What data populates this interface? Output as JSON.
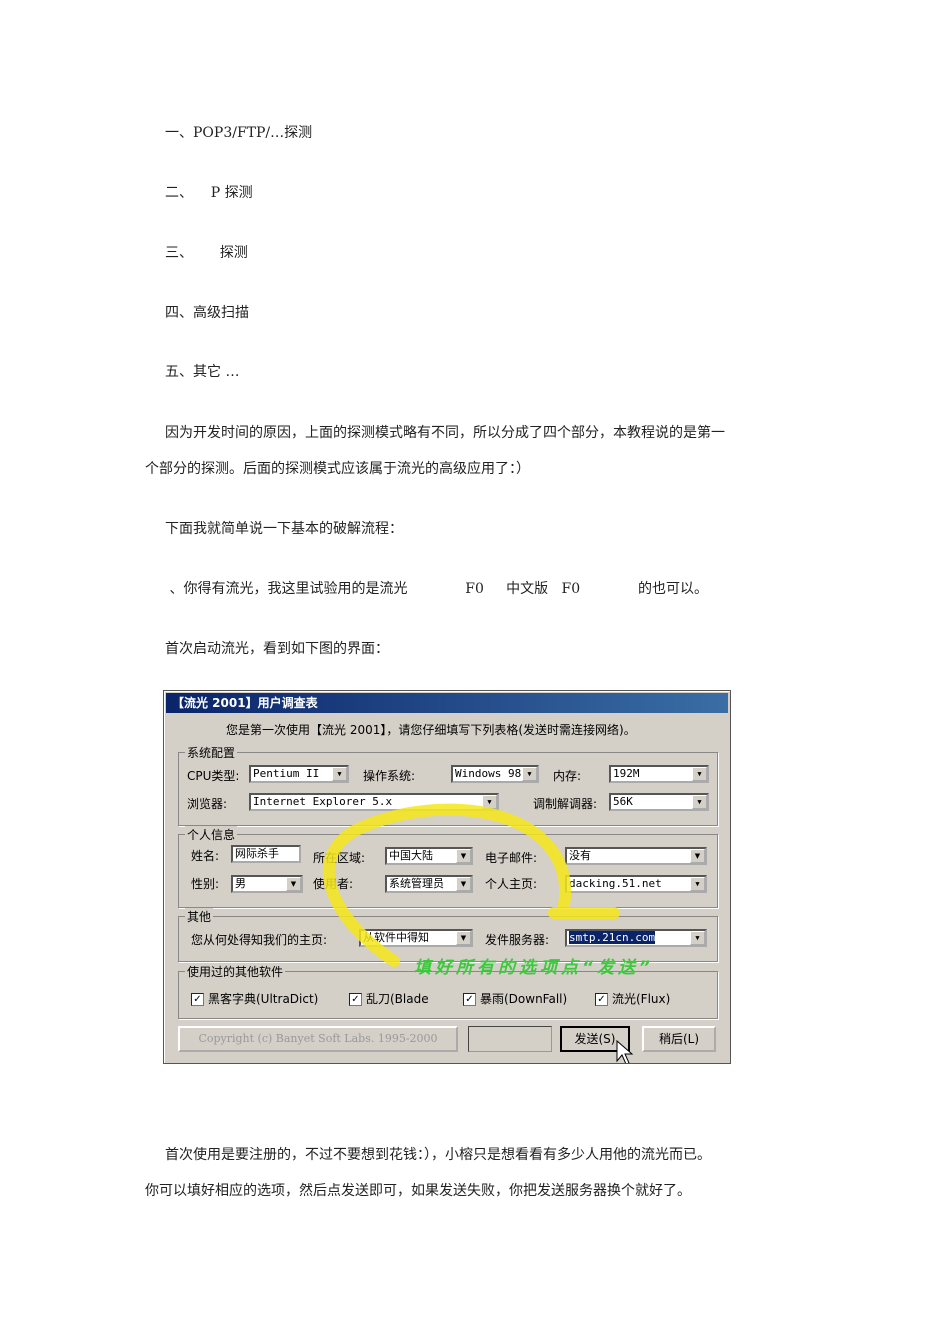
{
  "doc": {
    "items": [
      "一、POP3/FTP/…探测",
      "二、    P 探测",
      "三、      探测",
      "四、高级扫描",
      "五、其它 …"
    ],
    "para1": [
      "因为开发时间的原因，上面的探测模式略有不同，所以分成了四个部分，本教程说的是第一",
      "个部分的探测。后面的探测模式应该属于流光的高级应用了：）"
    ],
    "para2": "下面我就简单说一下基本的破解流程：",
    "para3": " 、你得有流光，我这里试验用的是流光             F0     中文版   F0             的也可以。",
    "para4": "首次启动流光，看到如下图的界面：",
    "para5": [
      "首次使用是要注册的，不过不要想到花钱：），小榕只是想看看有多少人用他的流光而已。",
      "你可以填好相应的选项，然后点发送即可，如果发送失败，你把发送服务器换个就好了。"
    ]
  },
  "dialog": {
    "title": "【流光 2001】用户调查表",
    "subtitle": "您是第一次使用【流光 2001】，请您仔细填写下列表格(发送时需连接网络)。",
    "sys": {
      "label": "系统配置",
      "cpu_label": "CPU类型:",
      "cpu": "Pentium II",
      "os_label": "操作系统:",
      "os": "Windows 98",
      "mem_label": "内存:",
      "mem": "192M",
      "browser_label": "浏览器:",
      "browser": "Internet Explorer 5.x",
      "modem_label": "调制解调器:",
      "modem": "56K"
    },
    "personal": {
      "label": "个人信息",
      "name_label": "姓名:",
      "name": "网际杀手",
      "region_label": "所在区域:",
      "region": "中国大陆",
      "email_label": "电子邮件:",
      "email": "没有",
      "sex_label": "性别:",
      "sex": "男",
      "user_label": "使用者:",
      "user": "系统管理员",
      "home_label": "个人主页:",
      "home": "dacking.51.net"
    },
    "other": {
      "label": "其他",
      "source_label": "您从何处得知我们的主页:",
      "source": "从软件中得知",
      "smtp_label": "发件服务器:",
      "smtp": "smtp.21cn.com"
    },
    "software": {
      "label": "使用过的其他软件",
      "items": [
        "黑客字典(UltraDict)",
        "乱刀(Blade",
        "暴雨(DownFall)",
        "流光(Flux)"
      ]
    },
    "copyright": "Copyright (c) Banyet Soft Labs. 1995-2000",
    "send": "发送(S)",
    "later": "稍后(L)",
    "annotation": "填好所有的选项点“发送”"
  }
}
